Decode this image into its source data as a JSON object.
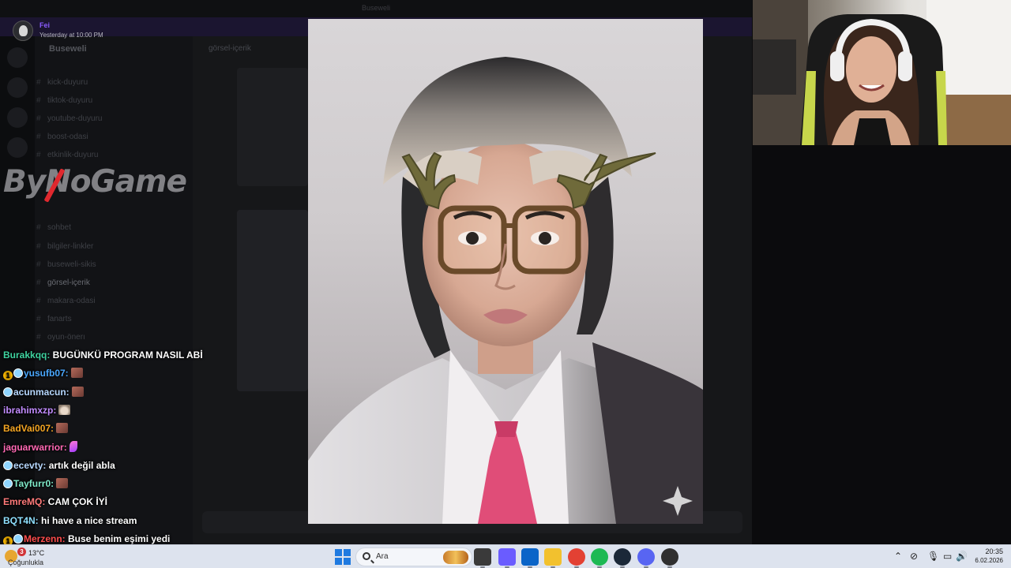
{
  "discord": {
    "window_title": "Buseweli",
    "server_name": "Buseweli",
    "channels": [
      {
        "label": "kick-duyuru"
      },
      {
        "label": "tiktok-duyuru"
      },
      {
        "label": "youtube-duyuru"
      },
      {
        "label": "boost-odasi"
      },
      {
        "label": "etkinlik-duyuru"
      },
      {
        "label": "sohbet"
      },
      {
        "label": "bilgiler-linkler"
      },
      {
        "label": "buseweli-sikis"
      },
      {
        "label": "görsel-içerik"
      },
      {
        "label": "makara-odasi"
      },
      {
        "label": "fanarts"
      },
      {
        "label": "oyun-önerı"
      }
    ],
    "chat_header": "görsel-içerik",
    "notification": {
      "user": "Fei",
      "time": "Yesterday at 10:00 PM"
    }
  },
  "logo": {
    "text": "ByNoGame"
  },
  "twitch_chat": [
    {
      "user": "Burakkqq:",
      "color": "#3fd3a0",
      "badges": [],
      "text": "BUGÜNKÜ PROGRAM NASIL ABİ",
      "emote": null
    },
    {
      "user": "yusufb07:",
      "color": "#4aa8ff",
      "badges": [
        "gold",
        "cyan"
      ],
      "text": "",
      "emote": "face"
    },
    {
      "user": "acunmacun:",
      "color": "#b7d8ff",
      "badges": [
        "cyan"
      ],
      "text": "",
      "emote": "face"
    },
    {
      "user": "ibrahimxzp:",
      "color": "#c28cff",
      "badges": [],
      "text": "",
      "emote": "cat"
    },
    {
      "user": "BadVai007:",
      "color": "#f5a623",
      "badges": [],
      "text": "",
      "emote": "face"
    },
    {
      "user": "jaguarwarrior:",
      "color": "#ff69b4",
      "badges": [],
      "text": "",
      "emote": "feather"
    },
    {
      "user": "ecevty:",
      "color": "#b7d8ff",
      "badges": [
        "cyan"
      ],
      "text": "artık değil abla",
      "emote": null
    },
    {
      "user": "Tayfurr0:",
      "color": "#7fe8c8",
      "badges": [
        "cyan"
      ],
      "text": "",
      "emote": "face"
    },
    {
      "user": "EmreMQ:",
      "color": "#ff7a7a",
      "badges": [],
      "text": "CAM ÇOK İYİ",
      "emote": null
    },
    {
      "user": "BQT4N:",
      "color": "#8fe0ff",
      "badges": [],
      "text": "hi have a nice stream",
      "emote": null
    },
    {
      "user": "Merzenn:",
      "color": "#ff4d4d",
      "badges": [
        "gold",
        "cyan"
      ],
      "text": "Buse benim eşimi yedi",
      "emote": null
    }
  ],
  "taskbar": {
    "weather": {
      "temp": "13°C",
      "condition": "Çoğunlukla",
      "badge": "3"
    },
    "search_placeholder": "Ara",
    "time": "20:35",
    "date": "6.02.2026",
    "apps": [
      "file-explorer-icon",
      "copilot-icon",
      "store-icon",
      "folder-icon",
      "chrome-icon",
      "spotify-icon",
      "steam-icon",
      "discord-icon",
      "obs-icon"
    ]
  },
  "colors": {
    "taskbar_bg": "#dde3ee",
    "discord_bg": "#111214",
    "accent_blue": "#1f7ae0"
  }
}
